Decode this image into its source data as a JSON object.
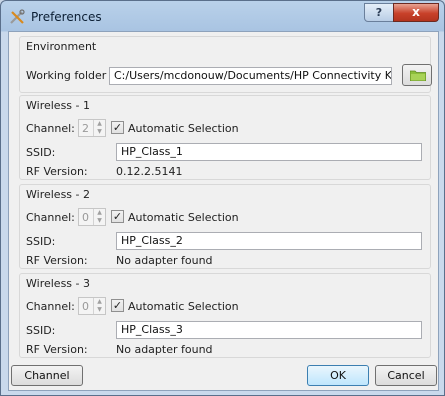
{
  "window": {
    "title": "Preferences",
    "help_label": "?",
    "close_label": "x"
  },
  "environment": {
    "title": "Environment",
    "working_folder_label": "Working folder",
    "working_folder_value": "C:/Users/mcdonouw/Documents/HP Connectivity Kit"
  },
  "wireless": [
    {
      "title": "Wireless - 1",
      "channel_label": "Channel:",
      "channel_value": "2",
      "auto_label": "Automatic Selection",
      "ssid_label": "SSID:",
      "ssid_value": "HP_Class_1",
      "rf_label": "RF Version:",
      "rf_value": "0.12.2.5141"
    },
    {
      "title": "Wireless - 2",
      "channel_label": "Channel:",
      "channel_value": "0",
      "auto_label": "Automatic Selection",
      "ssid_label": "SSID:",
      "ssid_value": "HP_Class_2",
      "rf_label": "RF Version:",
      "rf_value": "No adapter found"
    },
    {
      "title": "Wireless - 3",
      "channel_label": "Channel:",
      "channel_value": "0",
      "auto_label": "Automatic Selection",
      "ssid_label": "SSID:",
      "ssid_value": "HP_Class_3",
      "rf_label": "RF Version:",
      "rf_value": "No adapter found"
    }
  ],
  "footer": {
    "channel_button": "Channel",
    "ok_button": "OK",
    "cancel_button": "Cancel"
  },
  "icons": {
    "app": "tools-icon",
    "folder": "folder-icon",
    "check": "✓"
  },
  "colors": {
    "close_red": "#c8412a",
    "folder_green": "#8bbd3a"
  }
}
